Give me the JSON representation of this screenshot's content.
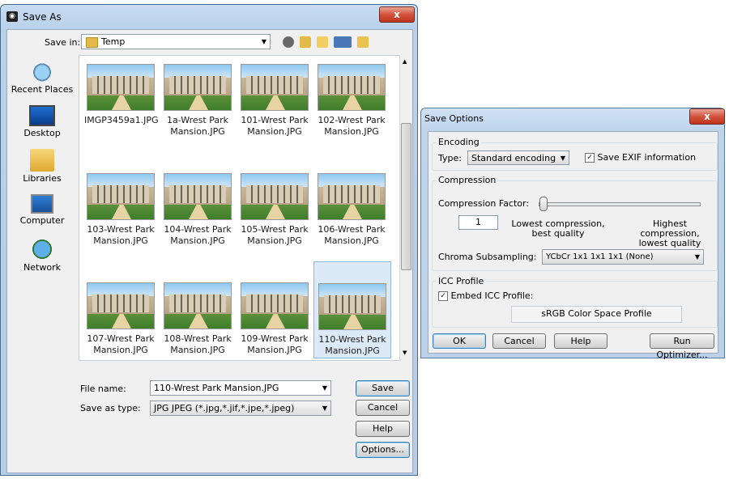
{
  "save_as": {
    "title": "Save As",
    "close_label": "x",
    "save_in_label": "Save in:",
    "save_in_value": "Temp",
    "places": [
      {
        "label": "Recent Places"
      },
      {
        "label": "Desktop"
      },
      {
        "label": "Libraries"
      },
      {
        "label": "Computer"
      },
      {
        "label": "Network"
      }
    ],
    "files": [
      {
        "line1": "IMGP3459a1.JPG",
        "line2": ""
      },
      {
        "line1": "1a-Wrest Park",
        "line2": "Mansion.JPG"
      },
      {
        "line1": "101-Wrest Park",
        "line2": "Mansion.JPG"
      },
      {
        "line1": "102-Wrest Park",
        "line2": "Mansion.JPG"
      },
      {
        "line1": "103-Wrest Park",
        "line2": "Mansion.JPG"
      },
      {
        "line1": "104-Wrest Park",
        "line2": "Mansion.JPG"
      },
      {
        "line1": "105-Wrest Park",
        "line2": "Mansion.JPG"
      },
      {
        "line1": "106-Wrest Park",
        "line2": "Mansion.JPG"
      },
      {
        "line1": "107-Wrest Park",
        "line2": "Mansion.JPG"
      },
      {
        "line1": "108-Wrest Park",
        "line2": "Mansion.JPG"
      },
      {
        "line1": "109-Wrest Park",
        "line2": "Mansion.JPG"
      },
      {
        "line1": "110-Wrest Park",
        "line2": "Mansion.JPG",
        "selected": true
      }
    ],
    "file_name_label": "File name:",
    "file_name_value": "110-Wrest Park Mansion.JPG",
    "save_type_label": "Save as type:",
    "save_type_value": "JPG JPEG  (*.jpg,*.jif,*.jpe,*.jpeg)",
    "buttons": {
      "save": "Save",
      "cancel": "Cancel",
      "help": "Help",
      "options": "Options..."
    }
  },
  "save_options": {
    "title": "Save Options",
    "close_label": "x",
    "encoding": {
      "group_title": "Encoding",
      "type_label": "Type:",
      "type_value": "Standard encoding",
      "exif_label": "Save EXIF information",
      "exif_checked": true
    },
    "compression": {
      "group_title": "Compression",
      "factor_label": "Compression Factor:",
      "factor_value": "1",
      "low_line1": "Lowest compression,",
      "low_line2": "best quality",
      "high_line1": "Highest compression,",
      "high_line2": "lowest quality",
      "slider_level": 0
    },
    "chroma": {
      "label": "Chroma Subsampling:",
      "value": "YCbCr  1x1  1x1  1x1  (None)"
    },
    "icc": {
      "group_title": "ICC Profile",
      "embed_label": "Embed ICC Profile:",
      "embed_checked": true,
      "profile_name": "sRGB Color Space Profile"
    },
    "buttons": {
      "ok": "OK",
      "cancel": "Cancel",
      "help": "Help",
      "run_optimizer": "Run Optimizer..."
    }
  },
  "colors": {
    "selection": "#dceaf7",
    "title_bar": "#b9d1ea",
    "close_button": "#c0331d"
  }
}
